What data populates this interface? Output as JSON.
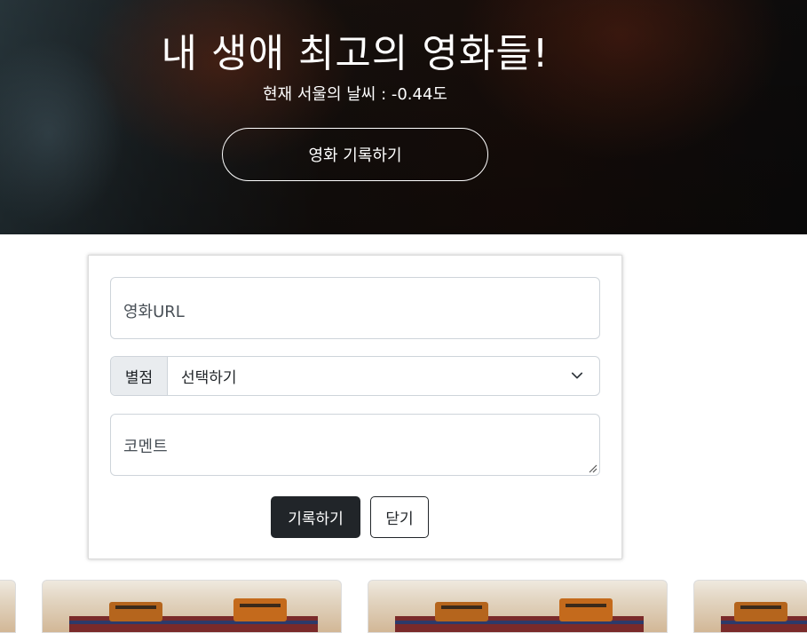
{
  "hero": {
    "title": "내 생애 최고의 영화들!",
    "weather": "현재 서울의 날씨 : -0.44도",
    "record_button": "영화 기록하기"
  },
  "form": {
    "url_placeholder": "영화URL",
    "star_label": "별점",
    "star_select_value": "선택하기",
    "comment_placeholder": "코멘트",
    "save_button": "기록하기",
    "close_button": "닫기"
  },
  "colors": {
    "dark_button": "#212529",
    "field_border": "#ced4da",
    "addon_bg": "#e9ecef"
  },
  "icons": {
    "select": "chevron-down-icon",
    "textarea": "resize-handle-icon"
  }
}
